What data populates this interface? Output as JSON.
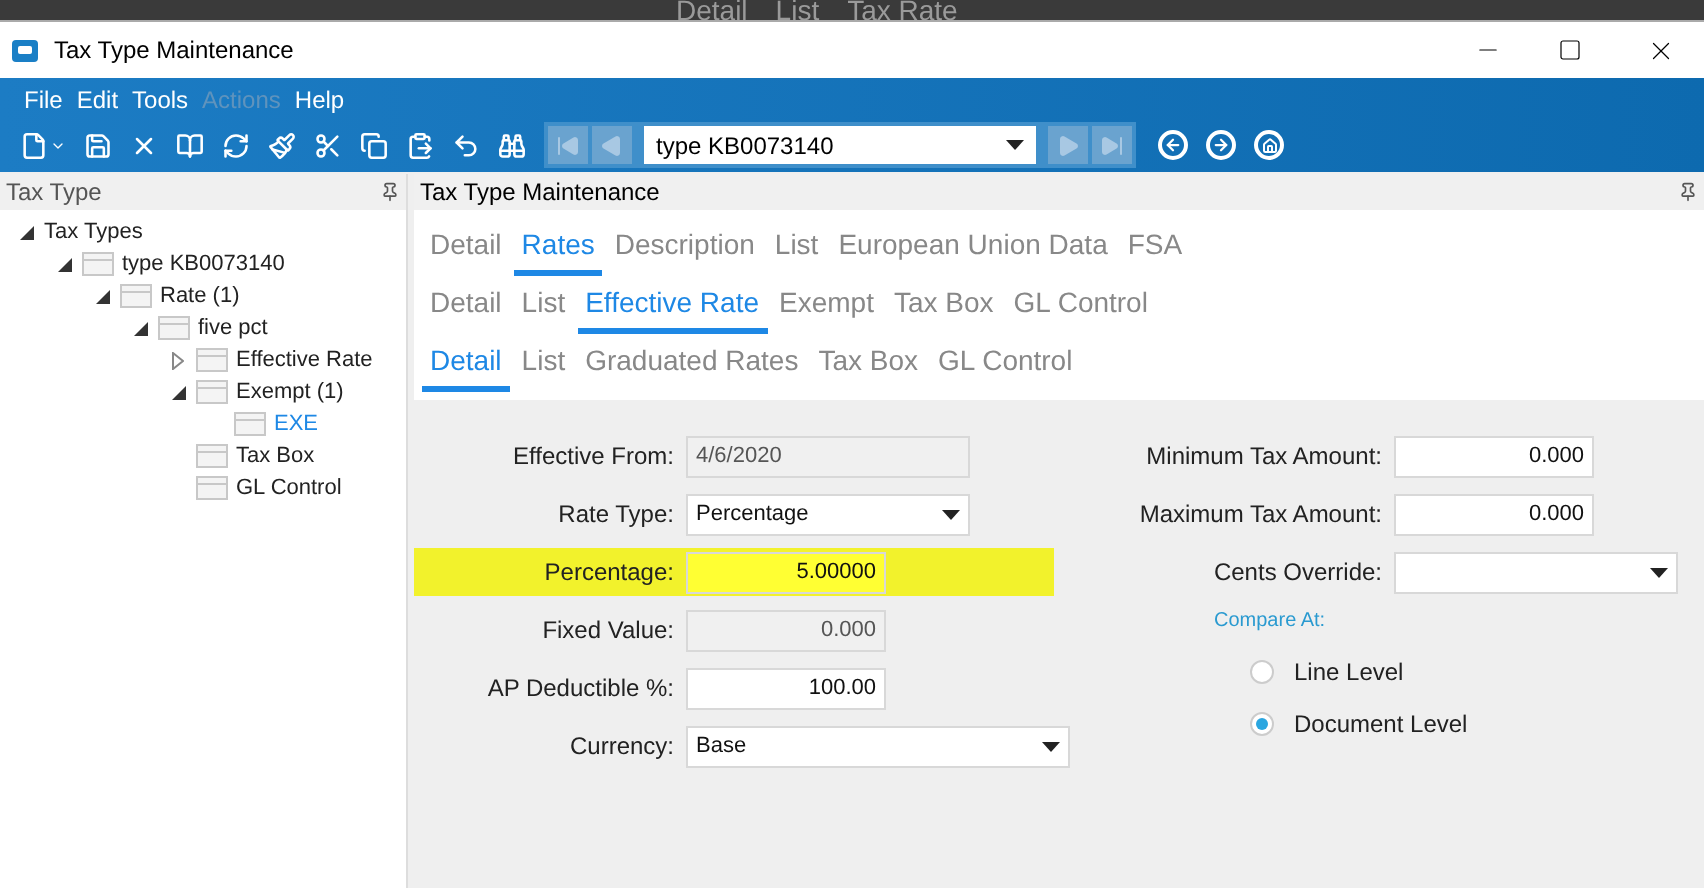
{
  "background_window": {
    "tabs": [
      "Detail",
      "List",
      "Tax Rate"
    ]
  },
  "window": {
    "title": "Tax Type Maintenance"
  },
  "menu": [
    {
      "label": "File",
      "disabled": false
    },
    {
      "label": "Edit",
      "disabled": false
    },
    {
      "label": "Tools",
      "disabled": false
    },
    {
      "label": "Actions",
      "disabled": true
    },
    {
      "label": "Help",
      "disabled": false
    }
  ],
  "toolbar": {
    "record": "type KB0073140"
  },
  "tree_panel": {
    "title": "Tax Type",
    "items": [
      {
        "label": "Tax Types",
        "expanded": true,
        "selected": false,
        "children": [
          {
            "label": "type KB0073140",
            "expanded": true,
            "selected": false,
            "children": [
              {
                "label": "Rate (1)",
                "expanded": true,
                "selected": false,
                "children": [
                  {
                    "label": "five pct",
                    "expanded": true,
                    "selected": false,
                    "children": [
                      {
                        "label": "Effective Rate",
                        "expanded": false,
                        "selected": false
                      },
                      {
                        "label": "Exempt (1)",
                        "expanded": true,
                        "selected": false,
                        "children": [
                          {
                            "label": "EXE",
                            "selected": true
                          }
                        ]
                      },
                      {
                        "label": "Tax Box",
                        "selected": false
                      },
                      {
                        "label": "GL Control",
                        "selected": false
                      }
                    ]
                  }
                ]
              }
            ]
          }
        ]
      }
    ]
  },
  "main": {
    "title": "Tax Type Maintenance",
    "tab_rows": [
      [
        {
          "label": "Detail",
          "selected": false
        },
        {
          "label": "Rates",
          "selected": true
        },
        {
          "label": "Description",
          "selected": false
        },
        {
          "label": "List",
          "selected": false
        },
        {
          "label": "European Union Data",
          "selected": false
        },
        {
          "label": "FSA",
          "selected": false
        }
      ],
      [
        {
          "label": "Detail",
          "selected": false
        },
        {
          "label": "List",
          "selected": false
        },
        {
          "label": "Effective Rate",
          "selected": true
        },
        {
          "label": "Exempt",
          "selected": false
        },
        {
          "label": "Tax Box",
          "selected": false
        },
        {
          "label": "GL Control",
          "selected": false
        }
      ],
      [
        {
          "label": "Detail",
          "selected": true
        },
        {
          "label": "List",
          "selected": false
        },
        {
          "label": "Graduated Rates",
          "selected": false
        },
        {
          "label": "Tax Box",
          "selected": false
        },
        {
          "label": "GL Control",
          "selected": false
        }
      ]
    ],
    "left_fields": [
      {
        "label": "Effective From:",
        "value": "4/6/2020",
        "kind": "date",
        "readonly": true,
        "highlighted": false
      },
      {
        "label": "Rate Type:",
        "value": "Percentage",
        "kind": "select",
        "readonly": false,
        "highlighted": false
      },
      {
        "label": "Percentage:",
        "value": "5.00000",
        "kind": "number",
        "readonly": false,
        "highlighted": true
      },
      {
        "label": "Fixed Value:",
        "value": "0.000",
        "kind": "number",
        "readonly": true,
        "highlighted": false
      },
      {
        "label": "AP Deductible %:",
        "value": "100.00",
        "kind": "number",
        "readonly": false,
        "highlighted": false
      },
      {
        "label": "Currency:",
        "value": "Base",
        "kind": "select",
        "readonly": false,
        "highlighted": false
      }
    ],
    "right_fields": [
      {
        "label": "Minimum Tax Amount:",
        "value": "0.000",
        "kind": "text"
      },
      {
        "label": "Maximum Tax Amount:",
        "value": "0.000",
        "kind": "text"
      },
      {
        "label": "Cents Override:",
        "kind": "select"
      }
    ],
    "compare_at": {
      "label": "Compare At:",
      "options": [
        {
          "label": "Line Level",
          "selected": false
        },
        {
          "label": "Document Level",
          "selected": true
        }
      ]
    }
  }
}
